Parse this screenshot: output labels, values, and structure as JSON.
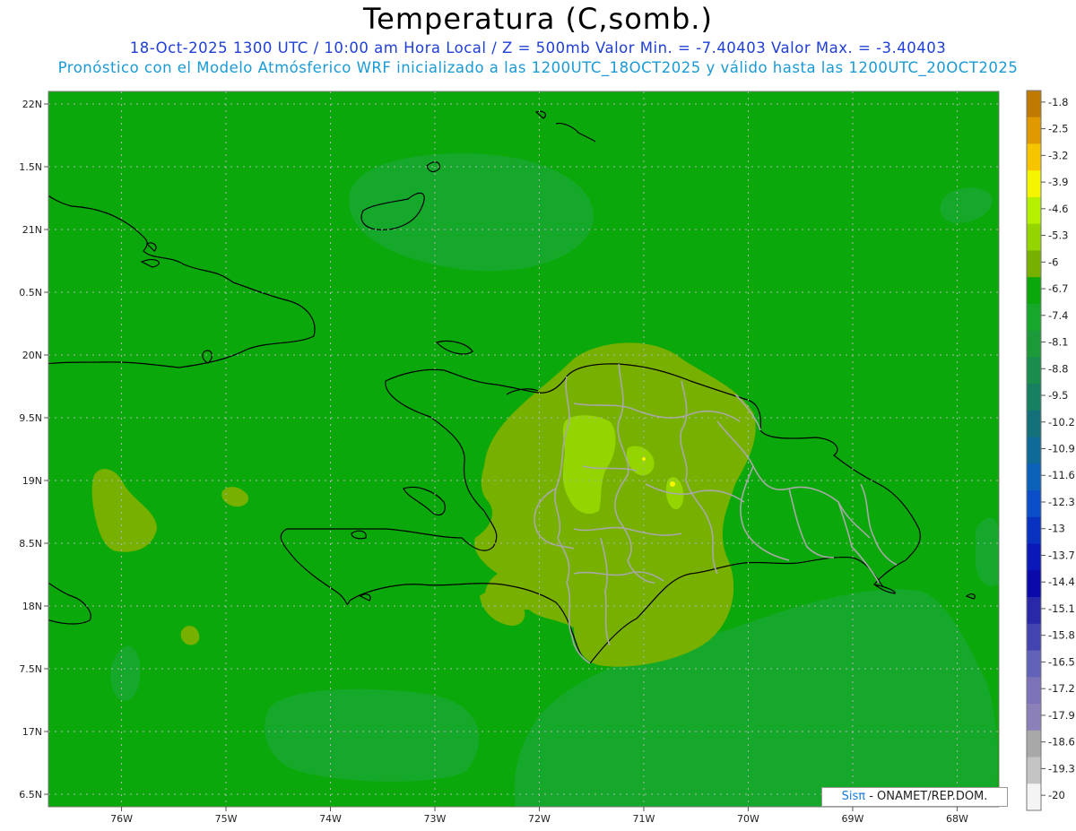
{
  "header": {
    "title": "Temperatura (C,somb.)",
    "subtitle1": "18-Oct-2025  1300 UTC / 10:00 am Hora Local / Z = 500mb  Valor Min. = -7.40403  Valor Max. = -3.40403",
    "subtitle2": "Pronóstico con el Modelo Atmósferico WRF inicializado a las 1200UTC_18OCT2025 y válido hasta las  1200UTC_20OCT2025"
  },
  "map": {
    "lat_range": [
      16.4,
      22.1
    ],
    "lon_range": [
      -76.7,
      -67.6
    ],
    "lat_ticks": [
      "22N",
      "1.5N",
      "21N",
      "0.5N",
      "20N",
      "9.5N",
      "19N",
      "8.5N",
      "18N",
      "7.5N",
      "17N",
      "6.5N"
    ],
    "lon_ticks": [
      "76W",
      "75W",
      "74W",
      "73W",
      "72W",
      "71W",
      "70W",
      "69W",
      "68W"
    ],
    "background_color": "#0aa80a"
  },
  "colorbar": {
    "labels": [
      "-1.8",
      "-2.5",
      "-3.2",
      "-3.9",
      "-4.6",
      "-5.3",
      "-6",
      "-6.7",
      "-7.4",
      "-8.1",
      "-8.8",
      "-9.5",
      "-10.2",
      "-10.9",
      "-11.6",
      "-12.3",
      "-13",
      "-13.7",
      "-14.4",
      "-15.1",
      "-15.8",
      "-16.5",
      "-17.2",
      "-17.9",
      "-18.6",
      "-19.3",
      "-20"
    ],
    "colors": [
      "#c07a00",
      "#e09a00",
      "#f7c400",
      "#f5f500",
      "#b5f000",
      "#94d400",
      "#78b000",
      "#0aa80a",
      "#16a82a",
      "#1c9a3a",
      "#1a8c4c",
      "#178060",
      "#147078",
      "#106a98",
      "#0c62b8",
      "#0a4ec8",
      "#0a32c0",
      "#0a18b8",
      "#0a0aaa",
      "#2828a8",
      "#4444b0",
      "#6262b8",
      "#7c72b8",
      "#8c80b8",
      "#a8a8a8",
      "#c4c4c4",
      "#f4f4f4"
    ]
  },
  "credit": {
    "sis": "Sisπ",
    "text": " - ONAMET/REP.DOM."
  }
}
